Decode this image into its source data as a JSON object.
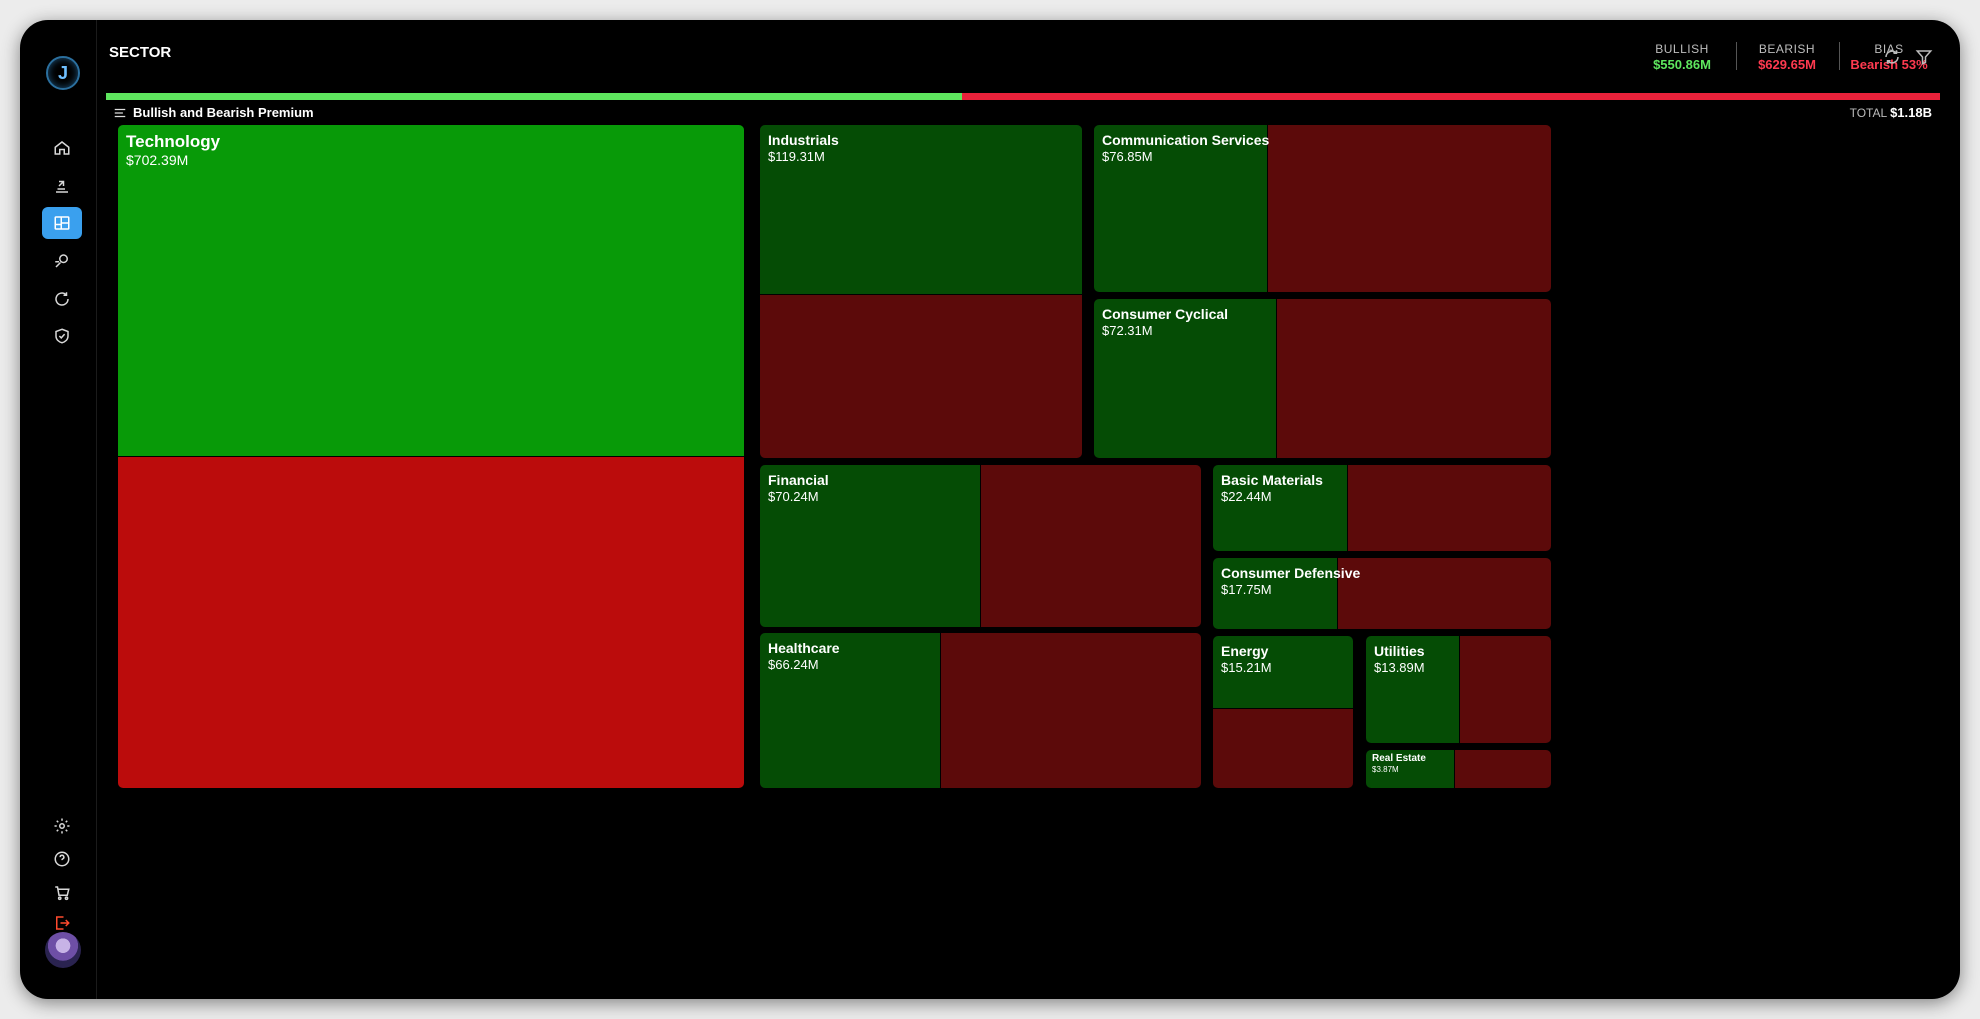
{
  "app": {
    "title": "SECTOR",
    "logo_letter": "J"
  },
  "nav": {
    "items": [
      {
        "name": "home-icon",
        "active": false
      },
      {
        "name": "flow-icon",
        "active": false
      },
      {
        "name": "treemap-icon",
        "active": true
      },
      {
        "name": "chart-search-icon",
        "active": false
      },
      {
        "name": "refresh-spark-icon",
        "active": false
      },
      {
        "name": "shield-check-icon",
        "active": false
      }
    ],
    "bottom_items": [
      "settings-icon",
      "help-icon",
      "cart-icon",
      "logout-icon"
    ]
  },
  "header": {
    "bullish_label": "BULLISH",
    "bullish_value": "$550.86M",
    "bearish_label": "BEARISH",
    "bearish_value": "$629.65M",
    "bias_label": "BIAS",
    "bias_value": "Bearish 53%",
    "bullish_share": 0.4666,
    "colors": {
      "bullish": "#5ee65e",
      "bearish": "#e8213a"
    }
  },
  "subheader": {
    "title": "Bullish and Bearish Premium",
    "total_label": "TOTAL",
    "total_value": "$1.18B"
  },
  "treemap": {
    "sectors": [
      {
        "name": "Technology",
        "premium": "$702.39M",
        "bullish_share": 0.5,
        "split": "v"
      },
      {
        "name": "Industrials",
        "premium": "$119.31M",
        "bullish_share": 0.51,
        "split": "v"
      },
      {
        "name": "Communication Services",
        "premium": "$76.85M",
        "bullish_share": 0.38,
        "split": "h"
      },
      {
        "name": "Consumer Cyclical",
        "premium": "$72.31M",
        "bullish_share": 0.4,
        "split": "h"
      },
      {
        "name": "Financial",
        "premium": "$70.24M",
        "bullish_share": 0.5,
        "split": "h"
      },
      {
        "name": "Healthcare",
        "premium": "$66.24M",
        "bullish_share": 0.41,
        "split": "h"
      },
      {
        "name": "Basic Materials",
        "premium": "$22.44M",
        "bullish_share": 0.4,
        "split": "h"
      },
      {
        "name": "Consumer Defensive",
        "premium": "$17.75M",
        "bullish_share": 0.37,
        "split": "h"
      },
      {
        "name": "Energy",
        "premium": "$15.21M",
        "bullish_share": 0.48,
        "split": "v"
      },
      {
        "name": "Utilities",
        "premium": "$13.89M",
        "bullish_share": 0.51,
        "split": "h"
      },
      {
        "name": "Real Estate",
        "premium": "$3.87M",
        "bullish_share": 0.48,
        "split": "h"
      }
    ]
  }
}
